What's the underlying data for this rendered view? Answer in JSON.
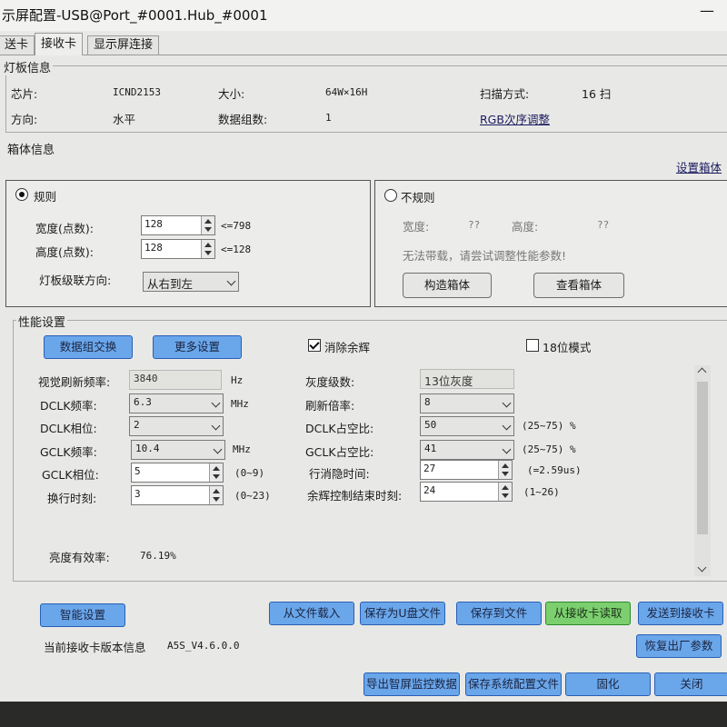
{
  "window": {
    "title": "示屏配置-USB@Port_#0001.Hub_#0001",
    "minimize": "—"
  },
  "tabs": [
    {
      "label": "送卡"
    },
    {
      "label": "接收卡"
    },
    {
      "label": "显示屏连接"
    }
  ],
  "lamp_board": {
    "legend": "灯板信息",
    "chip_label": "芯片:",
    "chip_value": "ICND2153",
    "size_label": "大小:",
    "size_value": "64W×16H",
    "scan_label": "扫描方式:",
    "scan_value": "16 扫",
    "direction_label": "方向:",
    "direction_value": "水平",
    "data_groups_label": "数据组数:",
    "data_groups_value": "1",
    "rgb_link": "RGB次序调整"
  },
  "cabinet": {
    "legend": "箱体信息",
    "settings_link": "设置箱体",
    "regular": {
      "label": "规则",
      "width_label": "宽度(点数):",
      "width_value": "128",
      "width_limit": "<=798",
      "height_label": "高度(点数):",
      "height_value": "128",
      "height_limit": "<=128",
      "cascade_label": "灯板级联方向:",
      "cascade_value": "从右到左"
    },
    "irregular": {
      "label": "不规则",
      "width_label": "宽度:",
      "width_value": "??",
      "height_label": "高度:",
      "height_value": "??",
      "message": "无法带载，请尝试调整性能参数!",
      "build_button": "构造箱体",
      "view_button": "查看箱体"
    }
  },
  "performance": {
    "legend": "性能设置",
    "data_exchange_button": "数据组交换",
    "more_settings_button": "更多设置",
    "ghost_elimination": "消除余辉",
    "bit18_mode": "18位模式",
    "refresh_label": "视觉刷新频率:",
    "refresh_value": "3840",
    "refresh_unit": "Hz",
    "gray_label": "灰度级数:",
    "gray_value": "13位灰度",
    "dclk_freq_label": "DCLK频率:",
    "dclk_freq_value": "6.3",
    "dclk_freq_unit": "MHz",
    "refresh_mult_label": "刷新倍率:",
    "refresh_mult_value": "8",
    "dclk_phase_label": "DCLK相位:",
    "dclk_phase_value": "2",
    "dclk_duty_label": "DCLK占空比:",
    "dclk_duty_value": "50",
    "dclk_duty_range": "(25~75) %",
    "gclk_freq_label": "GCLK频率:",
    "gclk_freq_value": "10.4",
    "gclk_freq_unit": "MHz",
    "gclk_duty_label": "GCLK占空比:",
    "gclk_duty_value": "41",
    "gclk_duty_range": "(25~75) %",
    "gclk_phase_label": "GCLK相位:",
    "gclk_phase_value": "5",
    "gclk_phase_range": "(0~9)",
    "blank_time_label": "行消隐时间:",
    "blank_time_value": "27",
    "blank_time_range": "(=2.59us)",
    "line_change_label": "换行时刻:",
    "line_change_value": "3",
    "line_change_range": "(0~23)",
    "ghost_end_label": "余辉控制结束时刻:",
    "ghost_end_value": "24",
    "ghost_end_range": "(1~26)",
    "brightness_eff_label": "亮度有效率:",
    "brightness_eff_value": "76.19%"
  },
  "bottom": {
    "smart_settings": "智能设置",
    "load_from_file": "从文件载入",
    "save_to_usb": "保存为U盘文件",
    "save_to_file": "保存到文件",
    "read_from_card": "从接收卡读取",
    "send_to_card": "发送到接收卡",
    "version_label": "当前接收卡版本信息",
    "version_value": "A5S_V4.6.0.0",
    "restore_factory": "恢复出厂参数",
    "export_monitor": "导出智屏监控数据",
    "save_system_config": "保存系统配置文件",
    "solidify": "固化",
    "close": "关闭"
  },
  "colors": {
    "blue_button": "#6aa6ea",
    "green_button": "#7ccf6e",
    "window_bg": "#e8e9e6"
  }
}
